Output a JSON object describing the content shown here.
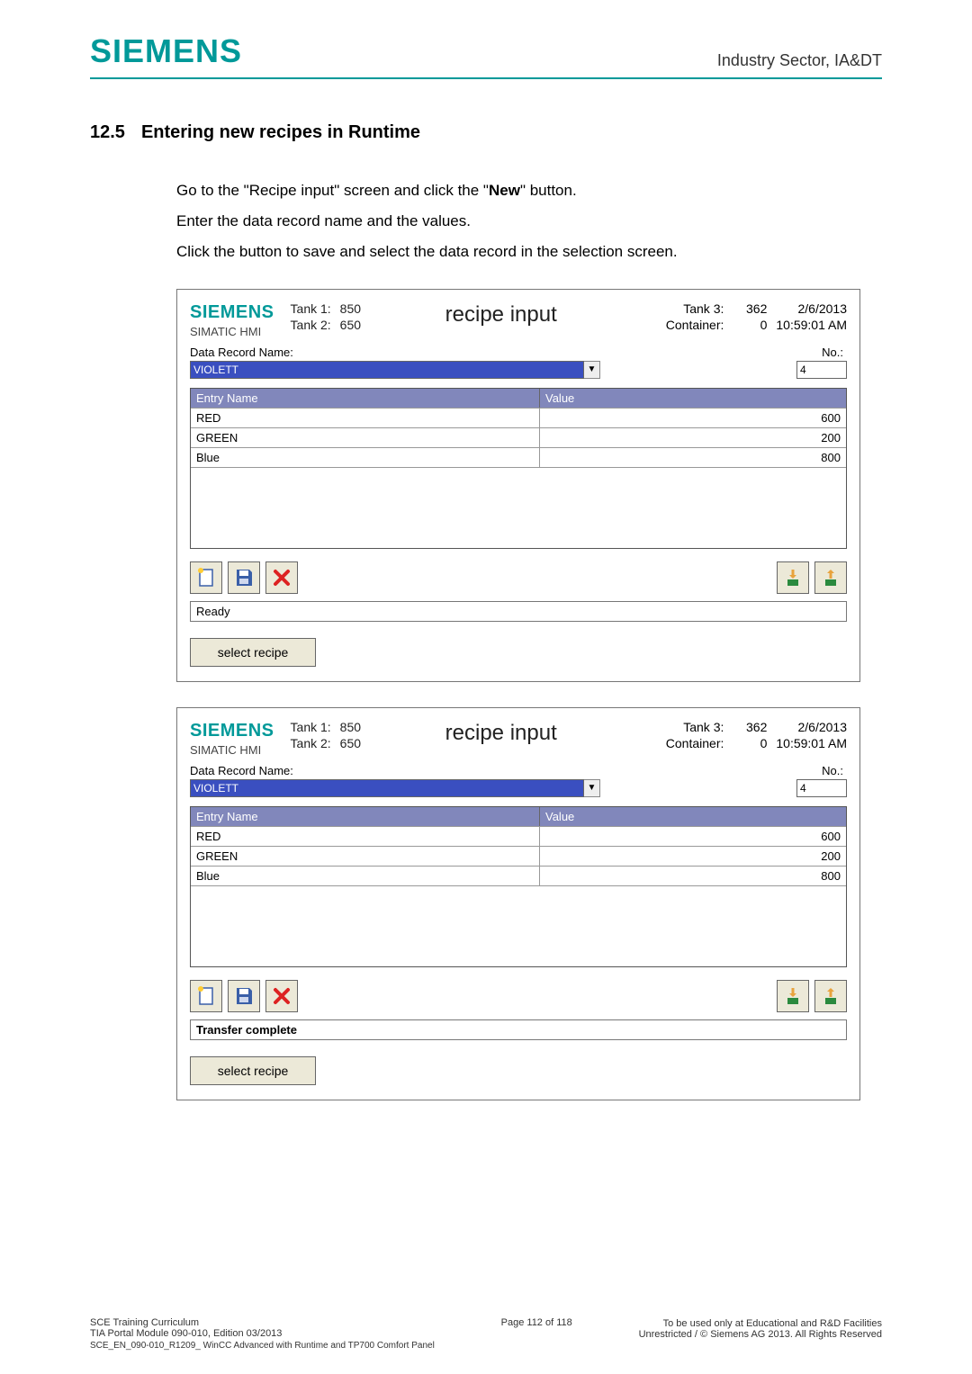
{
  "brand": "SIEMENS",
  "header": {
    "right": "Industry Sector, IA&DT"
  },
  "section": {
    "number": "12.5",
    "title": "Entering new recipes in Runtime"
  },
  "intro": {
    "line1_pre": "Go to the \"Recipe input\" screen and click the \"",
    "line1_bold": "New",
    "line1_post": "\" button.",
    "line2": "Enter the data record name and the values.",
    "line3": "Click the button to save and select the data record in the selection screen."
  },
  "hmi_common": {
    "logo": "SIEMENS",
    "sub": "SIMATIC HMI",
    "tank1_label": "Tank 1:",
    "tank2_label": "Tank 2:",
    "tank1_value": "850",
    "tank2_value": "650",
    "screen_title": "recipe input",
    "tank3_label": "Tank 3:",
    "container_label": "Container:",
    "tank3_value": "362",
    "container_value": "0",
    "date": "2/6/2013",
    "time": "10:59:01 AM",
    "data_record_name_label": "Data Record Name:",
    "data_record_name_value": "VIOLETT",
    "no_label": "No.:",
    "no_value": "4",
    "grid_header_entry": "Entry Name",
    "grid_header_value": "Value",
    "rows": [
      {
        "name": "RED",
        "value": "600"
      },
      {
        "name": "GREEN",
        "value": "200"
      },
      {
        "name": "Blue",
        "value": "800"
      }
    ],
    "select_button": "select recipe"
  },
  "panel1": {
    "status": "Ready"
  },
  "panel2": {
    "status": "Transfer complete"
  },
  "footer": {
    "left_line1": "SCE Training Curriculum",
    "left_line2": "TIA Portal Module 090-010, Edition 03/2013",
    "mid": "Page 112 of 118",
    "right_line1": "To be used only at Educational and R&D Facilities",
    "right_line2": "Unrestricted / © Siemens AG 2013. All Rights Reserved",
    "bottom": "SCE_EN_090-010_R1209_ WinCC Advanced with Runtime and TP700 Comfort Panel"
  }
}
